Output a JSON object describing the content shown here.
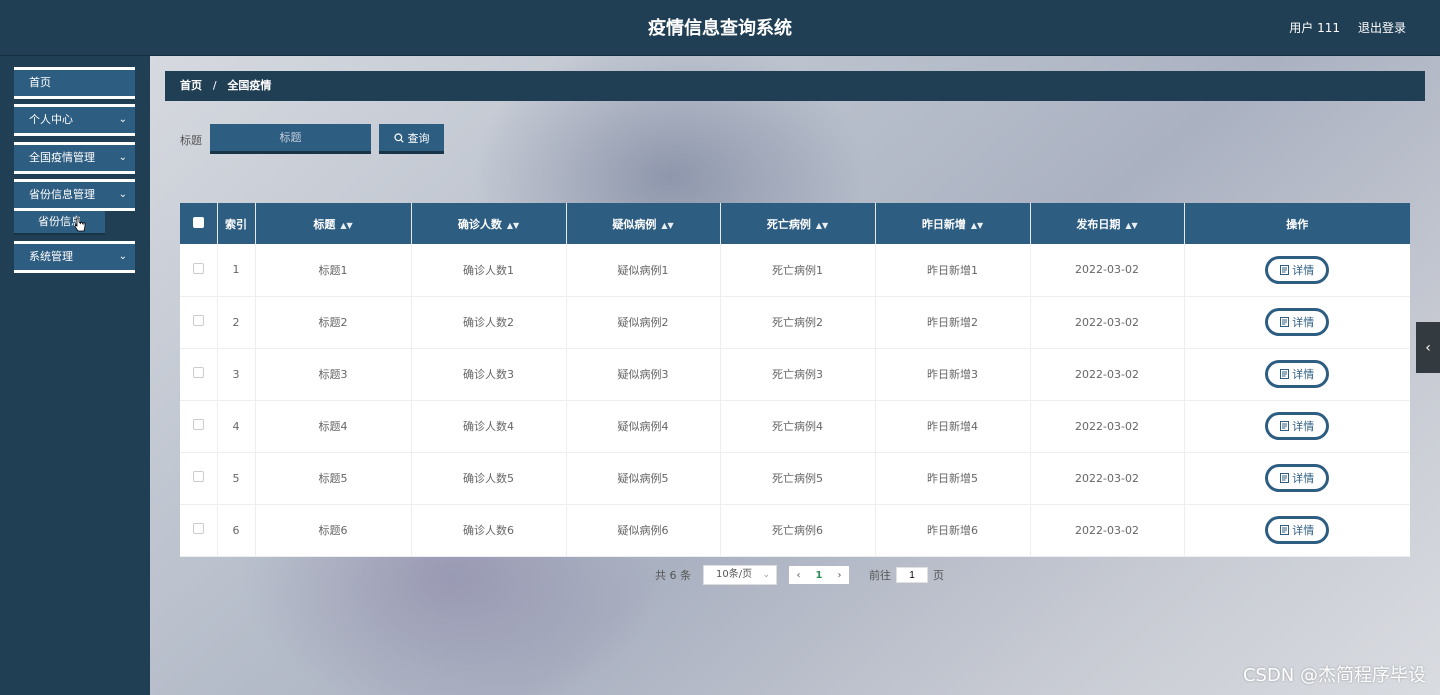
{
  "header": {
    "title": "疫情信息查询系统",
    "user_text": "用户 111",
    "logout_label": "退出登录"
  },
  "sidebar": {
    "items": [
      {
        "label": "首页",
        "has_children": false
      },
      {
        "label": "个人中心",
        "has_children": true
      },
      {
        "label": "全国疫情管理",
        "has_children": true
      },
      {
        "label": "省份信息管理",
        "has_children": true
      },
      {
        "label": "系统管理",
        "has_children": true
      }
    ],
    "submenu_label": "省份信息"
  },
  "breadcrumb": {
    "home": "首页",
    "separator": "/",
    "current": "全国疫情"
  },
  "search": {
    "label": "标题",
    "placeholder": "标题",
    "button_label": "查询"
  },
  "table": {
    "columns": [
      "索引",
      "标题",
      "确诊人数",
      "疑似病例",
      "死亡病例",
      "昨日新增",
      "发布日期",
      "操作"
    ],
    "rows": [
      {
        "index": "1",
        "title": "标题1",
        "confirmed": "确诊人数1",
        "suspected": "疑似病例1",
        "deaths": "死亡病例1",
        "new": "昨日新增1",
        "date": "2022-03-02"
      },
      {
        "index": "2",
        "title": "标题2",
        "confirmed": "确诊人数2",
        "suspected": "疑似病例2",
        "deaths": "死亡病例2",
        "new": "昨日新增2",
        "date": "2022-03-02"
      },
      {
        "index": "3",
        "title": "标题3",
        "confirmed": "确诊人数3",
        "suspected": "疑似病例3",
        "deaths": "死亡病例3",
        "new": "昨日新增3",
        "date": "2022-03-02"
      },
      {
        "index": "4",
        "title": "标题4",
        "confirmed": "确诊人数4",
        "suspected": "疑似病例4",
        "deaths": "死亡病例4",
        "new": "昨日新增4",
        "date": "2022-03-02"
      },
      {
        "index": "5",
        "title": "标题5",
        "confirmed": "确诊人数5",
        "suspected": "疑似病例5",
        "deaths": "死亡病例5",
        "new": "昨日新增5",
        "date": "2022-03-02"
      },
      {
        "index": "6",
        "title": "标题6",
        "confirmed": "确诊人数6",
        "suspected": "疑似病例6",
        "deaths": "死亡病例6",
        "new": "昨日新增6",
        "date": "2022-03-02"
      }
    ],
    "detail_label": "详情"
  },
  "pagination": {
    "total_text": "共 6 条",
    "page_size": "10条/页",
    "current_page": "1",
    "goto_prefix": "前往",
    "goto_value": "1",
    "goto_suffix": "页"
  },
  "watermark": "CSDN @杰简程序毕设",
  "colors": {
    "topbar": "#213f54",
    "accent": "#2e5d82",
    "page_current": "#2e8b57"
  }
}
